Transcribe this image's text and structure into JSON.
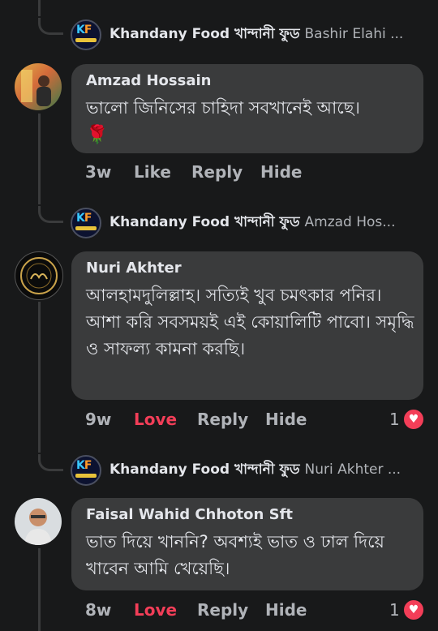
{
  "page_reply_author": "Khandany Food খান্দানী ফুড",
  "threads": [
    {
      "reply_tag": "Bashir Elahi ...",
      "comment": null
    },
    {
      "author": "Amzad Hossain",
      "text": "ভালো জিনিসের চাহিদা সবখানেই আছে।",
      "emoji": "🌹",
      "time": "3w",
      "actions": [
        "Like",
        "Reply",
        "Hide"
      ],
      "reply_tag": "Amzad Hos..."
    },
    {
      "author": "Nuri Akhter",
      "text": "আলহামদুলিল্লাহ। সত্যিই খুব চমৎকার পনির। আশা করি সবসময়ই এই কোয়ালিটি পাবো। সমৃদ্ধি ও সাফল্য কামনা করছি।",
      "time": "9w",
      "actions": [
        "Love",
        "Reply",
        "Hide"
      ],
      "reaction_count": "1",
      "reply_tag": "Nuri Akhter ..."
    },
    {
      "author": "Faisal Wahid Chhoton Sft",
      "text": "ভাত দিয়ে খাননি? অবশ্যই ভাত ও ঢাল দিয়ে খাবেন আমি খেয়েছি।",
      "time": "8w",
      "actions": [
        "Love",
        "Reply",
        "Hide"
      ],
      "reaction_count": "1"
    }
  ],
  "icons": {
    "page_logo": "khandany-food-logo",
    "reaction": "heart-icon"
  },
  "colors": {
    "background": "#18191a",
    "bubble": "#3a3b3c",
    "love": "#f33e58",
    "secondary_text": "#b0b3b8"
  }
}
